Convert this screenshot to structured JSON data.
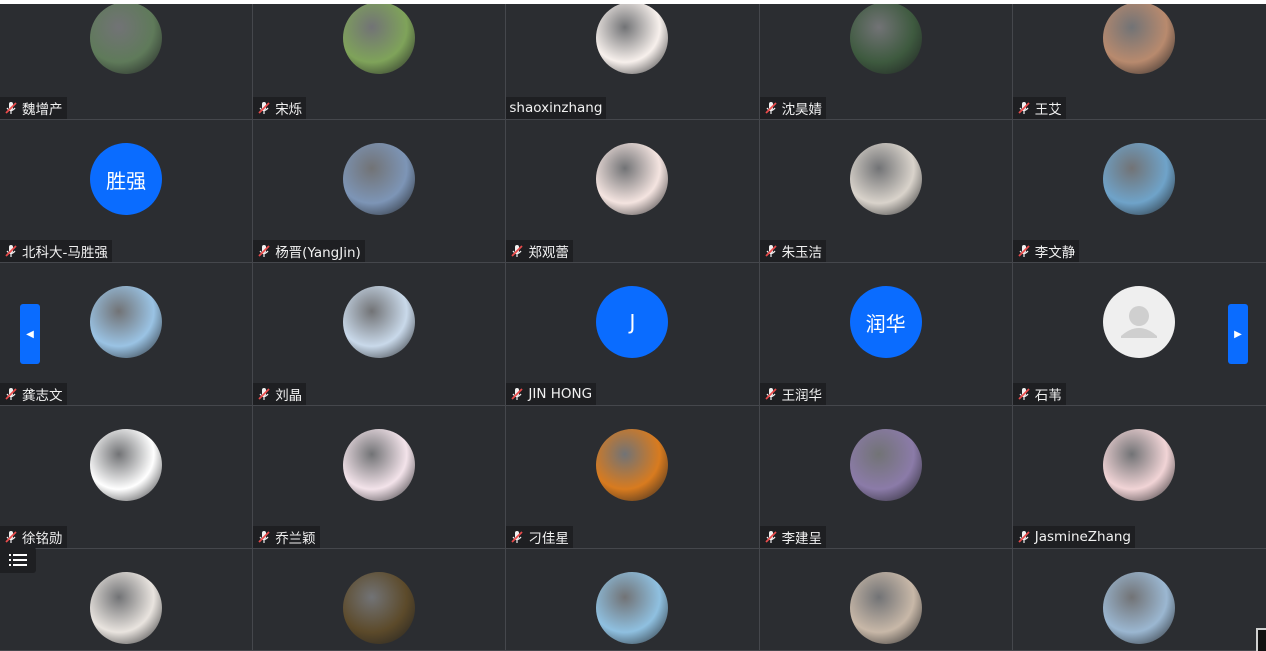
{
  "participants": [
    {
      "name": "魏增产",
      "avatar": "photo",
      "muted": true
    },
    {
      "name": "宋烁",
      "avatar": "photo",
      "muted": true
    },
    {
      "name": "shaoxinzhang",
      "avatar": "photo",
      "muted": false
    },
    {
      "name": "沈昊婧",
      "avatar": "photo",
      "muted": true
    },
    {
      "name": "王艾",
      "avatar": "photo",
      "muted": true
    },
    {
      "name": "北科大-马胜强",
      "avatar": "initials",
      "initials": "胜强",
      "muted": true
    },
    {
      "name": "杨晋(YangJin)",
      "avatar": "photo",
      "muted": true
    },
    {
      "name": "郑观蕾",
      "avatar": "photo",
      "muted": true
    },
    {
      "name": "朱玉洁",
      "avatar": "photo",
      "muted": true
    },
    {
      "name": "李文静",
      "avatar": "photo",
      "muted": true
    },
    {
      "name": "龚志文",
      "avatar": "photo",
      "muted": true
    },
    {
      "name": "刘晶",
      "avatar": "photo",
      "muted": true
    },
    {
      "name": "JIN HONG",
      "avatar": "initials",
      "initials": "J",
      "muted": true
    },
    {
      "name": "王润华",
      "avatar": "initials",
      "initials": "润华",
      "muted": true
    },
    {
      "name": "石苇",
      "avatar": "default",
      "muted": true
    },
    {
      "name": "徐铭勋",
      "avatar": "photo",
      "muted": true
    },
    {
      "name": "乔兰颖",
      "avatar": "photo",
      "muted": true
    },
    {
      "name": "刁佳星",
      "avatar": "photo",
      "muted": true
    },
    {
      "name": "李建呈",
      "avatar": "photo",
      "muted": true
    },
    {
      "name": "JasmineZhang",
      "avatar": "photo",
      "muted": true
    },
    {
      "name": "",
      "avatar": "photo",
      "muted": false
    },
    {
      "name": "",
      "avatar": "photo",
      "muted": false
    },
    {
      "name": "",
      "avatar": "photo",
      "muted": false
    },
    {
      "name": "",
      "avatar": "photo",
      "muted": false
    },
    {
      "name": "",
      "avatar": "photo",
      "muted": false
    }
  ],
  "avatar_colors": [
    "#5f7a5a",
    "#7fa35a",
    "#f7f0ec",
    "#3e5a3f",
    "#b88a6e",
    "#0a6cff",
    "#7d95b6",
    "#f4e4e0",
    "#d9d3cb",
    "#6fa3c9",
    "#9ac3e4",
    "#c9d9ea",
    "#0a6cff",
    "#0a6cff",
    "#efefef",
    "#ffffff",
    "#f3e3ea",
    "#d87b1f",
    "#8b7ba8",
    "#f1d4d6",
    "#e9e4df",
    "#5c4a2a",
    "#8fc0e0",
    "#c8b8a8",
    "#9bb7d1"
  ],
  "theme": {
    "tile_bg": "#2b2d31",
    "nameplate_bg": "#1e1f22",
    "accent": "#0a6cff",
    "muted_mic": "#e94b4b"
  },
  "icons": {
    "mic_muted": "mic-muted-icon",
    "nav_left": "chevron-left-icon",
    "nav_right": "chevron-right-icon",
    "list": "list-icon"
  }
}
